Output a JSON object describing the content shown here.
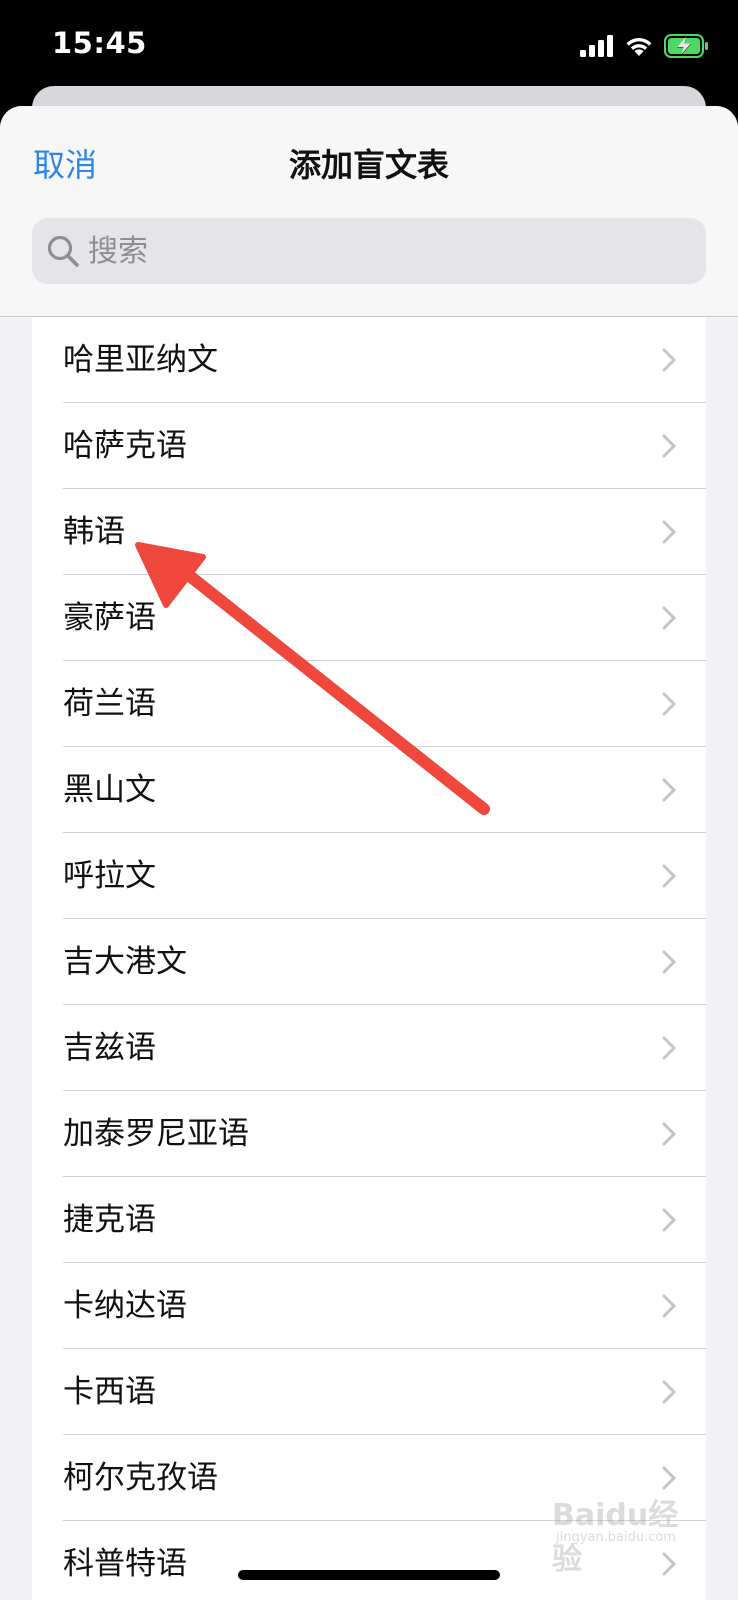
{
  "status_bar": {
    "time": "15:45",
    "icons": [
      "signal-icon",
      "wifi-icon",
      "battery-charging-icon"
    ],
    "battery_color": "#4cd964"
  },
  "sheet": {
    "cancel_label": "取消",
    "title": "添加盲文表",
    "search_placeholder": "搜索"
  },
  "languages": [
    "哈里亚纳文",
    "哈萨克语",
    "韩语",
    "豪萨语",
    "荷兰语",
    "黑山文",
    "呼拉文",
    "吉大港文",
    "吉兹语",
    "加泰罗尼亚语",
    "捷克语",
    "卡纳达语",
    "卡西语",
    "柯尔克孜语",
    "科普特语"
  ],
  "colors": {
    "accent": "#2f86e6",
    "arrow": "#f0473c",
    "list_background": "#ffffff",
    "sheet_background": "#f2f2f7"
  },
  "watermark": {
    "logo": "Baidu经验",
    "url": "jingyan.baidu.com"
  }
}
